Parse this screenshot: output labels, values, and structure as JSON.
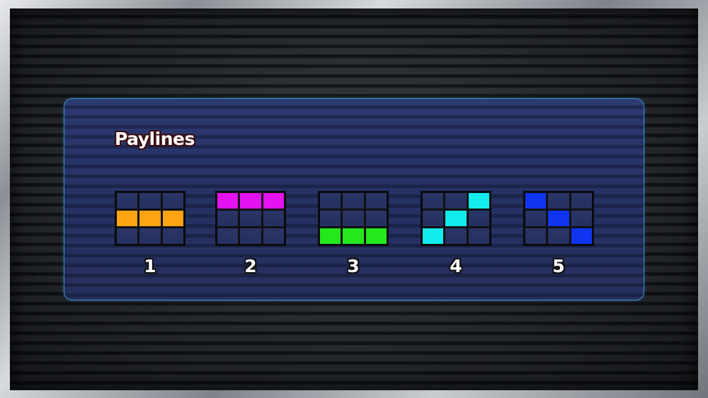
{
  "title": "Paylines",
  "colors": {
    "frame": "#b9bcc0",
    "panel": "#263264",
    "panel_border": "#3f8fc9",
    "grid_border": "#0a0a0c"
  },
  "paylines": [
    {
      "label": "1",
      "color": "#ffa412",
      "cells": [
        [
          1,
          0
        ],
        [
          1,
          1
        ],
        [
          1,
          2
        ]
      ]
    },
    {
      "label": "2",
      "color": "#e312f0",
      "cells": [
        [
          0,
          0
        ],
        [
          0,
          1
        ],
        [
          0,
          2
        ]
      ]
    },
    {
      "label": "3",
      "color": "#24e81c",
      "cells": [
        [
          2,
          0
        ],
        [
          2,
          1
        ],
        [
          2,
          2
        ]
      ]
    },
    {
      "label": "4",
      "color": "#13ecec",
      "cells": [
        [
          2,
          0
        ],
        [
          1,
          1
        ],
        [
          0,
          2
        ]
      ]
    },
    {
      "label": "5",
      "color": "#0f35f0",
      "cells": [
        [
          0,
          0
        ],
        [
          1,
          1
        ],
        [
          2,
          2
        ]
      ]
    }
  ]
}
